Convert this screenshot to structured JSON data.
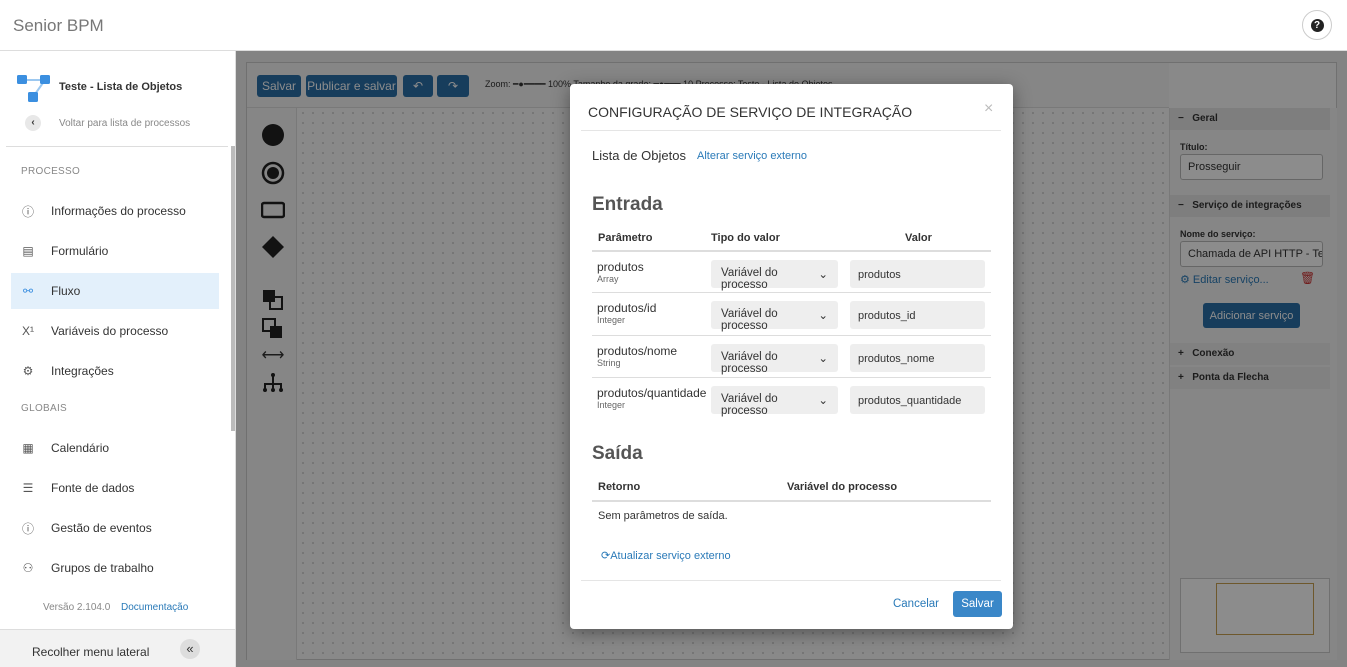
{
  "header": {
    "title": "Senior BPM",
    "help_icon": "question-circle-icon"
  },
  "sidebar": {
    "process_name": "Teste - Lista de Objetos",
    "back_label": "Voltar para lista de processos",
    "section_process": "PROCESSO",
    "process_items": [
      {
        "label": "Informações do processo",
        "icon": "info-icon"
      },
      {
        "label": "Formulário",
        "icon": "form-icon"
      },
      {
        "label": "Fluxo",
        "icon": "flow-icon",
        "active": true
      },
      {
        "label": "Variáveis do processo",
        "icon": "variable-icon"
      },
      {
        "label": "Integrações",
        "icon": "integrations-icon"
      }
    ],
    "section_globals": "GLOBAIS",
    "global_items": [
      {
        "label": "Calendário",
        "icon": "calendar-icon"
      },
      {
        "label": "Fonte de dados",
        "icon": "database-icon"
      },
      {
        "label": "Gestão de eventos",
        "icon": "events-icon"
      },
      {
        "label": "Grupos de trabalho",
        "icon": "groups-icon"
      }
    ],
    "version": "Versão 2.104.0",
    "docs_link": "Documentação",
    "collapse_label": "Recolher menu lateral"
  },
  "toolbar": {
    "save": "Salvar",
    "publish": "Publicar e salvar",
    "info": "Zoom: ━●━━━━ 100%   Tamanho da grade: ━●━━━ 10   Processo: Teste - Lista de Objetos"
  },
  "properties": {
    "general": "Geral",
    "title_label": "Título:",
    "title_value": "Prosseguir",
    "integration": "Serviço de integrações",
    "service_label": "Nome do serviço:",
    "service_value": "Chamada de API HTTP - Teste",
    "edit_service": "Editar serviço...",
    "add_service": "Adicionar serviço",
    "connection": "Conexão",
    "arrow_tip": "Ponta da Flecha"
  },
  "modal": {
    "title": "CONFIGURAÇÃO DE SERVIÇO DE INTEGRAÇÃO",
    "close": "×",
    "service_name": "Lista de Objetos",
    "change_service": "Alterar serviço externo",
    "input_heading": "Entrada",
    "input_columns": [
      "Parâmetro",
      "Tipo do valor",
      "Valor"
    ],
    "inputs": [
      {
        "param": "produtos",
        "type": "Array",
        "value_type": "Variável do processo",
        "value": "produtos"
      },
      {
        "param": "produtos/id",
        "type": "Integer",
        "value_type": "Variável do processo",
        "value": "produtos_id"
      },
      {
        "param": "produtos/nome",
        "type": "String",
        "value_type": "Variável do processo",
        "value": "produtos_nome"
      },
      {
        "param": "produtos/quantidade",
        "type": "Integer",
        "value_type": "Variável do processo",
        "value": "produtos_quantidade"
      }
    ],
    "output_heading": "Saída",
    "output_columns": [
      "Retorno",
      "Variável do processo"
    ],
    "no_output": "Sem parâmetros de saída.",
    "refresh": "Atualizar serviço externo",
    "cancel": "Cancelar",
    "save": "Salvar"
  },
  "colors": {
    "primary": "#2a6fa8",
    "link": "#2a7ab8",
    "active_nav": "#e3f0fb"
  }
}
